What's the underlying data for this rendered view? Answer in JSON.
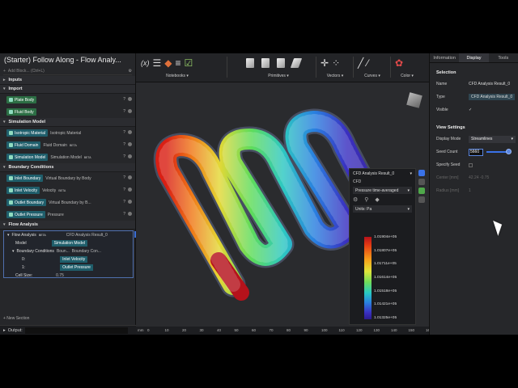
{
  "app": {
    "title": "(Starter) Follow Along - Flow Analy..."
  },
  "left": {
    "add_block_placeholder": "Add Block... (Ctrl+L)",
    "inputs_label": "Inputs",
    "sections": {
      "import": "Import",
      "simulation_model": "Simulation Model",
      "boundary_conditions": "Boundary Conditions",
      "flow_analysis": "Flow Analysis"
    },
    "import_items": [
      {
        "label": "Plate Body"
      },
      {
        "label": "Fluid Body"
      }
    ],
    "sim_items": [
      {
        "label": "Isotropic Material",
        "desc": "Isotropic Material",
        "beta": ""
      },
      {
        "label": "Fluid Domain",
        "desc": "Fluid Domain",
        "beta": "BETA"
      },
      {
        "label": "Simulation Model",
        "desc": "Simulation Model",
        "beta": "BETA"
      }
    ],
    "bc_items": [
      {
        "label": "Inlet Boundary",
        "desc": "Virtual Boundary by Body"
      },
      {
        "label": "Inlet Velocity",
        "desc": "Velocity",
        "beta": "BETA"
      },
      {
        "label": "Outlet Boundary",
        "desc": "Virtual Boundary by B..."
      },
      {
        "label": "Outlet Pressure",
        "desc": "Pressure"
      }
    ],
    "flow": {
      "label": "Flow Analysis",
      "beta": "BETA",
      "result": "CFD Analysis Result_0",
      "model_key": "Model",
      "model_val": "Simulation Model",
      "bc_key": "Boundary Conditions",
      "bc_sub": "Boun...",
      "bc_val": "Boundary Con...",
      "i0": "0:",
      "i0_val": "Inlet Velocity",
      "i1": "1:",
      "i1_val": "Outlet Pressure",
      "cell_key": "Cell Size:",
      "cell_val": "0.75"
    },
    "new_section": "+ New Section",
    "output_label": "Output:"
  },
  "toolbar": {
    "groups": [
      "Notebooks",
      "Primitives",
      "Vectors",
      "Curves",
      "Color"
    ],
    "fx": "(x)"
  },
  "legend": {
    "title": "CFD Analysis Result_0",
    "sub": "CFD",
    "quantity": "Pressure time-averaged",
    "units": "Units: Pa",
    "ticks": [
      "1.01904e+05",
      "1.01807e+05",
      "1.01711e+05",
      "1.01614e+05",
      "1.01518e+05",
      "1.01421e+05",
      "1.01325e+05"
    ]
  },
  "ruler": {
    "unit": "mm",
    "ticks": [
      "0",
      "10",
      "20",
      "30",
      "40",
      "50",
      "60",
      "70",
      "80",
      "90",
      "100",
      "110",
      "120",
      "130",
      "140",
      "150",
      "160"
    ]
  },
  "right": {
    "tabs": [
      "Information",
      "Display",
      "Tools"
    ],
    "active_tab": "Display",
    "selection_title": "Selection",
    "name_key": "Name",
    "name_val": "CFD Analysis Result_0",
    "type_key": "Type",
    "type_val": "CFD Analysis Result_0",
    "visible_key": "Visible",
    "visible_val": "✓",
    "view_title": "View Settings",
    "mode_key": "Display Mode",
    "mode_val": "Streamlines",
    "seed_key": "Seed Count",
    "seed_val": "5660",
    "seed_level": 0.9,
    "specify_key": "Specify Seed",
    "center_key": "Center [mm]",
    "center_val": "42.24   -0.75",
    "radius_key": "Radius [mm]",
    "radius_val": "1"
  },
  "colors": {
    "accent": "#3a72e8",
    "chip_green": "#2c6e44",
    "chip_teal": "#1f5e6b"
  }
}
